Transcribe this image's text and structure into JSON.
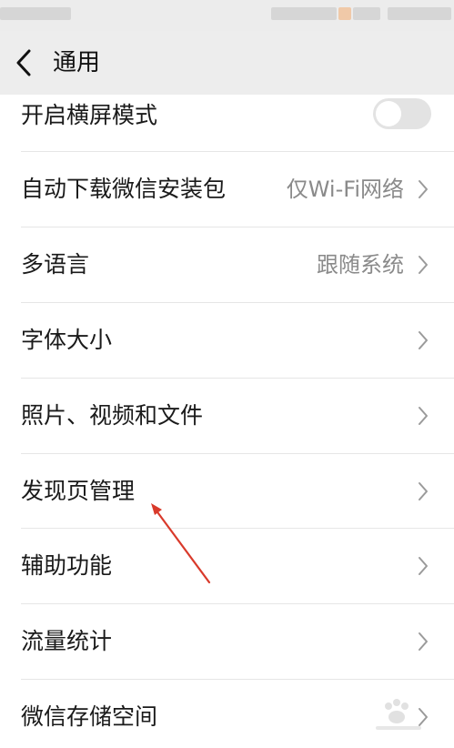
{
  "header": {
    "title": "通用"
  },
  "settings": {
    "items": [
      {
        "label": "开启横屏模式",
        "value": "",
        "control": "toggle",
        "toggle_on": false
      },
      {
        "label": "自动下载微信安装包",
        "value": "仅Wi-Fi网络",
        "control": "chevron"
      },
      {
        "label": "多语言",
        "value": "跟随系统",
        "control": "chevron"
      },
      {
        "label": "字体大小",
        "value": "",
        "control": "chevron"
      },
      {
        "label": "照片、视频和文件",
        "value": "",
        "control": "chevron"
      },
      {
        "label": "发现页管理",
        "value": "",
        "control": "chevron"
      },
      {
        "label": "辅助功能",
        "value": "",
        "control": "chevron"
      },
      {
        "label": "流量统计",
        "value": "",
        "control": "chevron"
      },
      {
        "label": "微信存储空间",
        "value": "",
        "control": "chevron"
      }
    ]
  },
  "annotation": {
    "color": "#d93a2b",
    "icon": "red-arrow-annotation"
  },
  "colors": {
    "header_bg": "#ededed",
    "row_bg": "#ffffff",
    "value_text": "#8a8a8a",
    "divider": "#e6e6e6"
  }
}
